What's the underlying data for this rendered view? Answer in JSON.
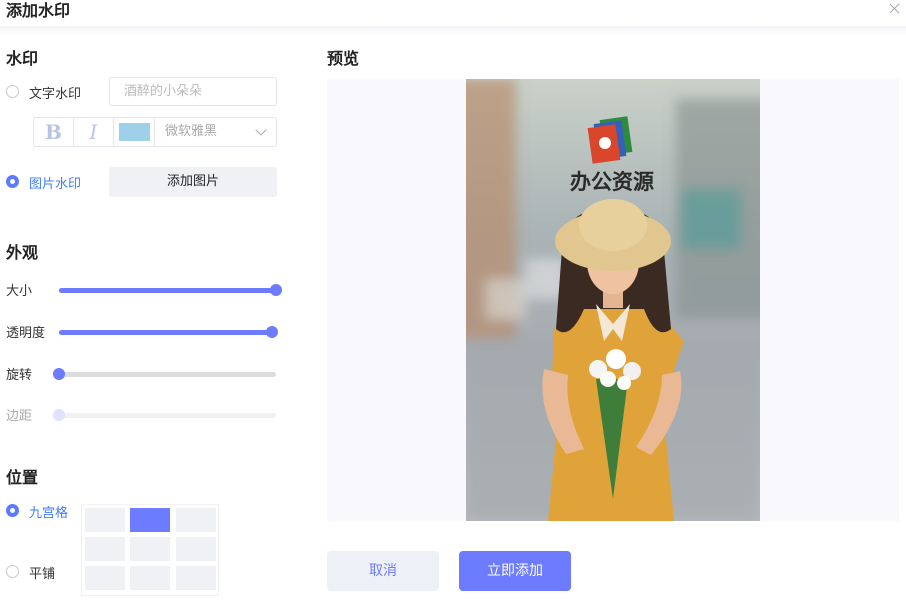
{
  "dialog": {
    "title": "添加水印"
  },
  "watermark": {
    "heading": "水印",
    "text_option": {
      "label": "文字水印",
      "selected": false
    },
    "text_input": {
      "placeholder": "酒醉的小朵朵"
    },
    "format": {
      "bold": "B",
      "italic": "I",
      "color": "#9fd0e9",
      "font": "微软雅黑"
    },
    "image_option": {
      "label": "图片水印",
      "selected": true
    },
    "add_image_button": "添加图片"
  },
  "appearance": {
    "heading": "外观",
    "sliders": [
      {
        "label": "大小",
        "value": 1.0,
        "enabled": true
      },
      {
        "label": "透明度",
        "value": 0.98,
        "enabled": true
      },
      {
        "label": "旋转",
        "value": 0.0,
        "enabled": true
      },
      {
        "label": "边距",
        "value": 0.0,
        "enabled": false
      }
    ]
  },
  "position": {
    "heading": "位置",
    "grid_option": {
      "label": "九宫格",
      "selected": true
    },
    "tile_option": {
      "label": "平铺",
      "selected": false
    },
    "grid_selected": "top-center"
  },
  "preview": {
    "heading": "预览",
    "watermark_text": "办公资源"
  },
  "actions": {
    "cancel": "取消",
    "confirm": "立即添加"
  },
  "colors": {
    "accent": "#6c7bff",
    "radio_on": "#5b7bff",
    "label_on": "#3f7dff",
    "cell": "#f0f1f5"
  }
}
